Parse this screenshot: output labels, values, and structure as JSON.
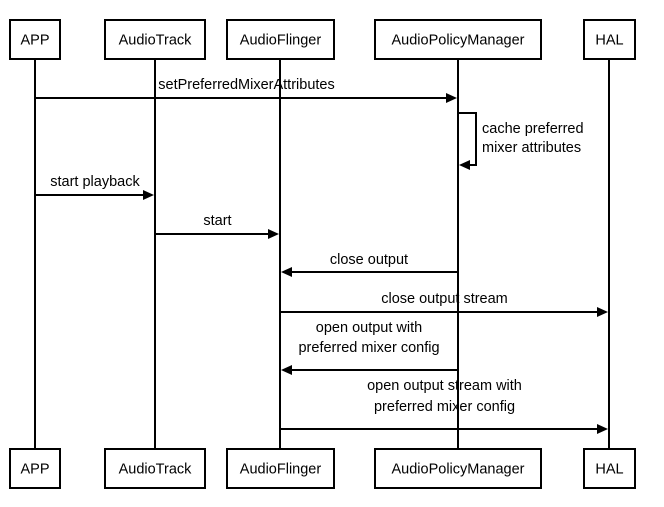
{
  "diagram": {
    "type": "sequence",
    "participants": [
      {
        "id": "app",
        "label": "APP"
      },
      {
        "id": "audiotrack",
        "label": "AudioTrack"
      },
      {
        "id": "audioflinger",
        "label": "AudioFlinger"
      },
      {
        "id": "apm",
        "label": "AudioPolicyManager"
      },
      {
        "id": "hal",
        "label": "HAL"
      }
    ],
    "messages": [
      {
        "from": "app",
        "to": "apm",
        "lines": [
          "setPreferredMixerAttributes"
        ]
      },
      {
        "from": "apm",
        "to": "apm",
        "lines": [
          "cache preferred",
          "mixer attributes"
        ]
      },
      {
        "from": "app",
        "to": "audiotrack",
        "lines": [
          "start playback"
        ]
      },
      {
        "from": "audiotrack",
        "to": "audioflinger",
        "lines": [
          "start"
        ]
      },
      {
        "from": "apm",
        "to": "audioflinger",
        "lines": [
          "close output"
        ]
      },
      {
        "from": "audioflinger",
        "to": "hal",
        "lines": [
          "close output stream"
        ]
      },
      {
        "from": "apm",
        "to": "audioflinger",
        "lines": [
          "open output with",
          "preferred mixer config"
        ]
      },
      {
        "from": "audioflinger",
        "to": "hal",
        "lines": [
          "open output stream with",
          "preferred mixer config"
        ]
      }
    ]
  }
}
